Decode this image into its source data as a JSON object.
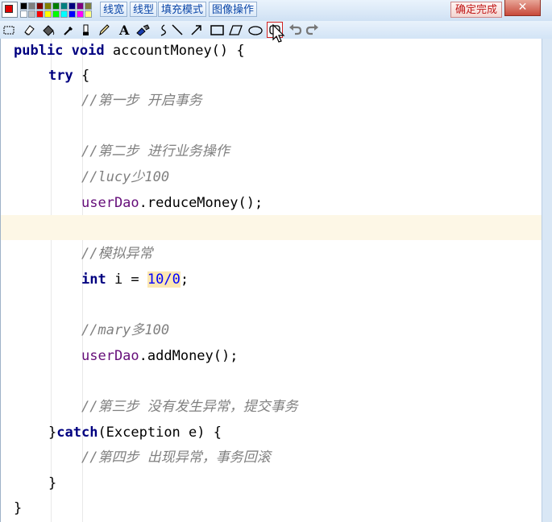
{
  "palette": {
    "current_fg": "#e00000",
    "colors": [
      "#000000",
      "#808080",
      "#800000",
      "#808000",
      "#008000",
      "#008080",
      "#000080",
      "#800080",
      "#808040",
      "#ffffff",
      "#c0c0c0",
      "#ff0000",
      "#ffff00",
      "#00ff00",
      "#00ffff",
      "#0000ff",
      "#ff00ff",
      "#ffff80"
    ]
  },
  "toolbar": {
    "line_width": "线宽",
    "line_type": "线型",
    "fill_mode": "填充模式",
    "image_ops": "图像操作",
    "confirm": "确定完成"
  },
  "tools": [
    "select-rect",
    "eraser",
    "fill-bucket",
    "color-picker",
    "marker",
    "pencil",
    "text",
    "brush",
    "curve",
    "line",
    "arrow",
    "rectangle",
    "parallelogram",
    "ellipse",
    "rounded-rect",
    "undo",
    "redo"
  ],
  "code": {
    "l1": {
      "kw1": "public",
      "kw2": "void",
      "rest": " accountMoney() {"
    },
    "l2": {
      "kw": "try",
      "rest": " {"
    },
    "l3": {
      "comment": "//第一步 开启事务"
    },
    "l4": {
      "comment": "//第二步 进行业务操作"
    },
    "l5": {
      "comment": "//lucy少100"
    },
    "l6": {
      "field": "userDao",
      "rest": ".reduceMoney();"
    },
    "l7": {
      "comment": "//模拟异常"
    },
    "l8": {
      "kw": "int",
      "mid": " i = ",
      "num": "10/0",
      "end": ";"
    },
    "l9": {
      "comment": "//mary多100"
    },
    "l10": {
      "field": "userDao",
      "rest": ".addMoney();"
    },
    "l11": {
      "comment": "//第三步 没有发生异常，提交事务"
    },
    "l12": {
      "brace": "}",
      "kw": "catch",
      "rest": "(Exception e) {"
    },
    "l13": {
      "comment": "//第四步 出现异常，事务回滚"
    },
    "l14": {
      "text": "}"
    },
    "l15": {
      "text": "}"
    }
  }
}
